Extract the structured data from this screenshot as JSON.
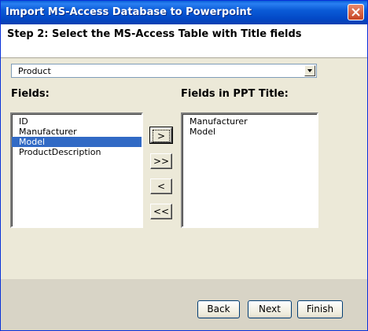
{
  "window": {
    "title": "Import MS-Access Database to Powerpoint"
  },
  "header": {
    "step": "Step 2: Select the MS-Access Table with Title fields"
  },
  "table_select": {
    "value": "Product"
  },
  "fields": {
    "label": "Fields:",
    "items": [
      "ID",
      "Manufacturer",
      "Model",
      "ProductDescription"
    ],
    "selected": "Model"
  },
  "title_fields": {
    "label": "Fields in PPT Title:",
    "items": [
      "Manufacturer",
      "Model"
    ]
  },
  "move_buttons": {
    "add": ">",
    "add_all": ">>",
    "remove": "<",
    "remove_all": "<<"
  },
  "footer": {
    "back": "Back",
    "next": "Next",
    "finish": "Finish"
  },
  "icons": {
    "close": "close-icon",
    "dropdown": "dropdown-arrow-icon"
  }
}
